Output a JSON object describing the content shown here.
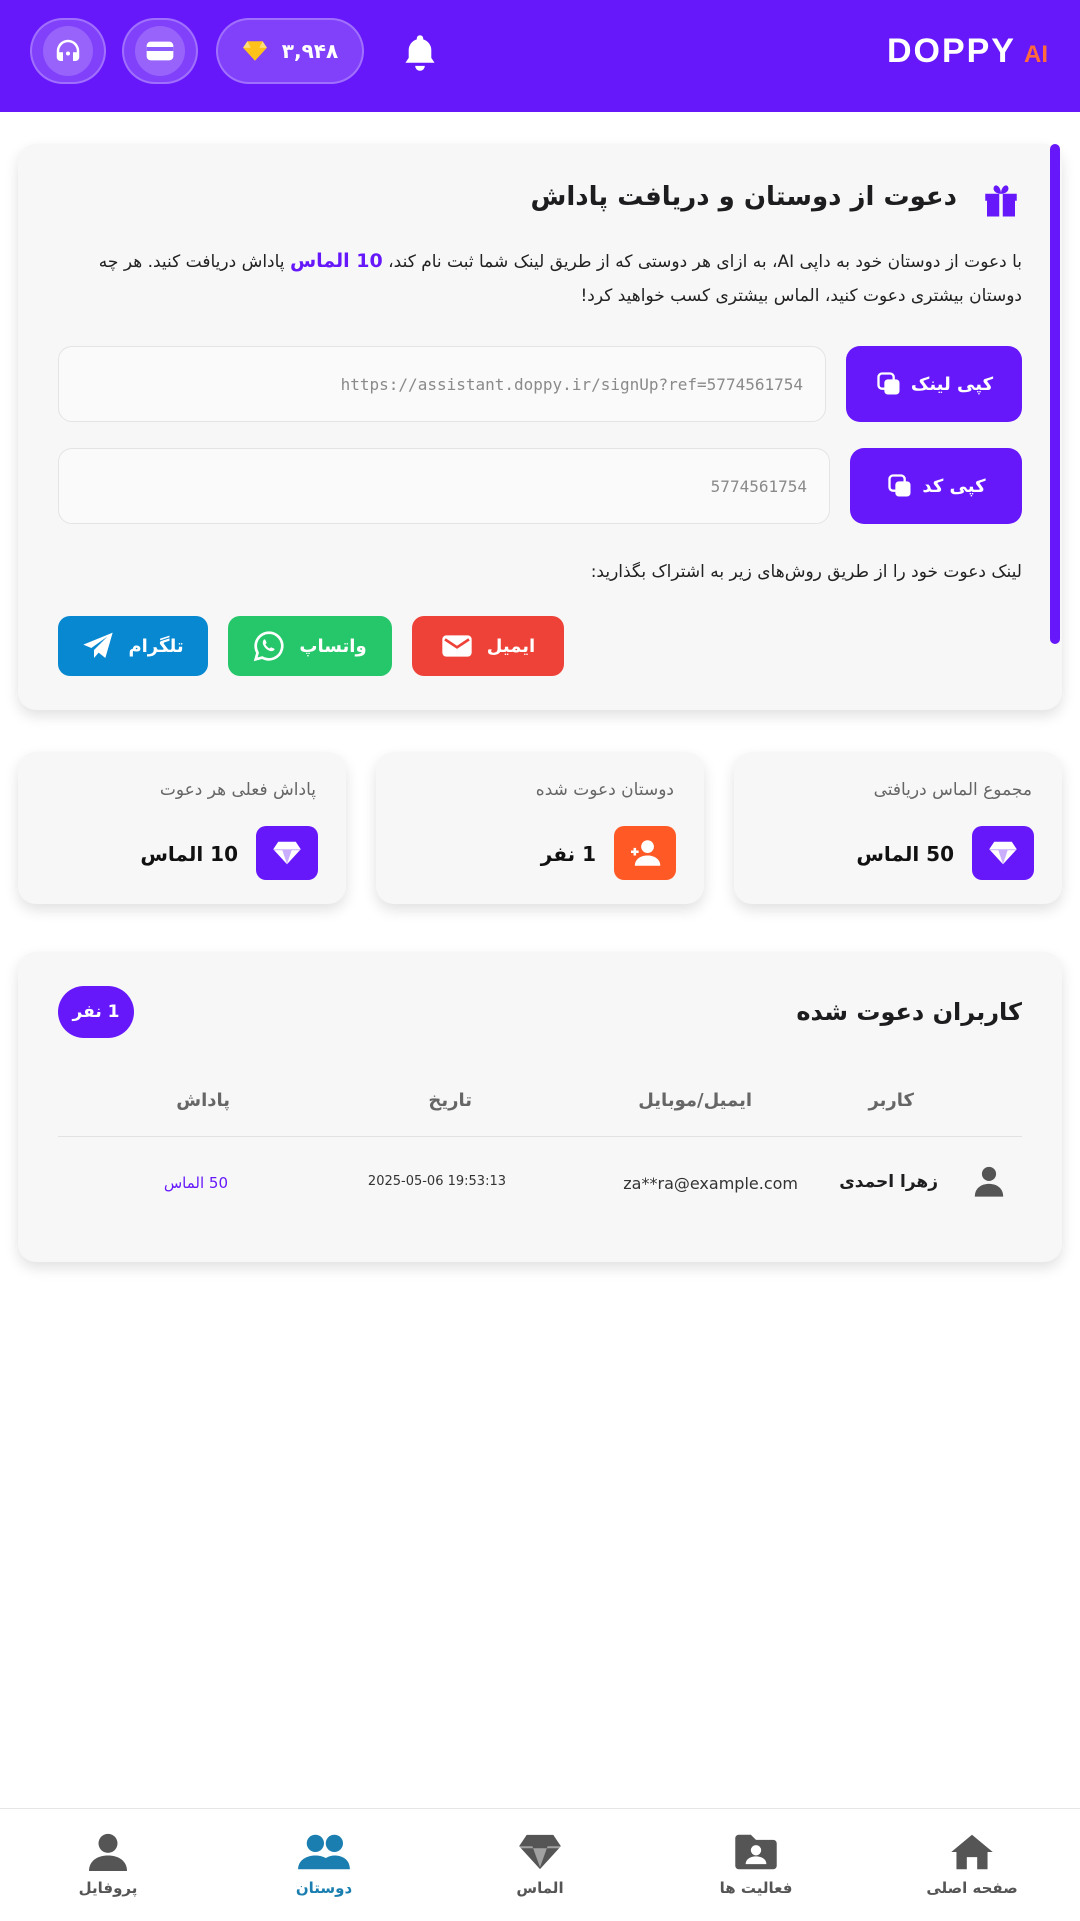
{
  "header": {
    "brand": "DOPPY",
    "brand_suffix": "AI",
    "diamond_balance": "۳,۹۴۸"
  },
  "invite": {
    "title": "دعوت از دوستان و دریافت پاداش",
    "desc_part1": "با دعوت از دوستان خود به داپی AI، به ازای هر دوستی که از طریق لینک شما ثبت نام کند، ",
    "desc_highlight": "10 الماس",
    "desc_part2": " پاداش دریافت کنید. هر چه دوستان بیشتری دعوت کنید، الماس بیشتری کسب خواهید کرد!",
    "link_value": "https://assistant.doppy.ir/signUp?ref=5774561754",
    "code_value": "5774561754",
    "copy_link_label": "کپی لینک",
    "copy_code_label": "کپی کد",
    "share_hint": "لینک دعوت خود را از طریق روش‌های زیر به اشتراک بگذارید:",
    "share_email": "ایمیل",
    "share_whatsapp": "واتساپ",
    "share_telegram": "تلگرام"
  },
  "stats": {
    "total_label": "مجموع الماس دریافتی",
    "total_value": "50 الماس",
    "invited_label": "دوستان دعوت شده",
    "invited_value": "1 نفر",
    "reward_label": "پاداش فعلی هر دعوت",
    "reward_value": "10 الماس"
  },
  "users": {
    "title": "کاربران دعوت شده",
    "count": "1 نفر",
    "columns": [
      "کاربر",
      "ایمیل/موبایل",
      "تاریخ",
      "پاداش"
    ],
    "rows": [
      {
        "name": "زهرا احمدی",
        "contact": "za**ra@example.com",
        "date": "2025-05-06 19:53:13",
        "reward": "50 الماس"
      }
    ]
  },
  "nav": [
    {
      "label": "صفحه اصلی",
      "icon": "home-icon"
    },
    {
      "label": "فعالیت ها",
      "icon": "folder-user-icon"
    },
    {
      "label": "الماس",
      "icon": "diamond-icon"
    },
    {
      "label": "دوستان",
      "icon": "users-icon",
      "active": true
    },
    {
      "label": "پروفایل",
      "icon": "user-icon"
    }
  ],
  "colors": {
    "primary": "#6618fb",
    "email": "#ee4238",
    "whatsapp": "#25c76a",
    "telegram": "#0788d0",
    "orange": "#ff5a26",
    "nav_active": "#1a7fb0"
  }
}
